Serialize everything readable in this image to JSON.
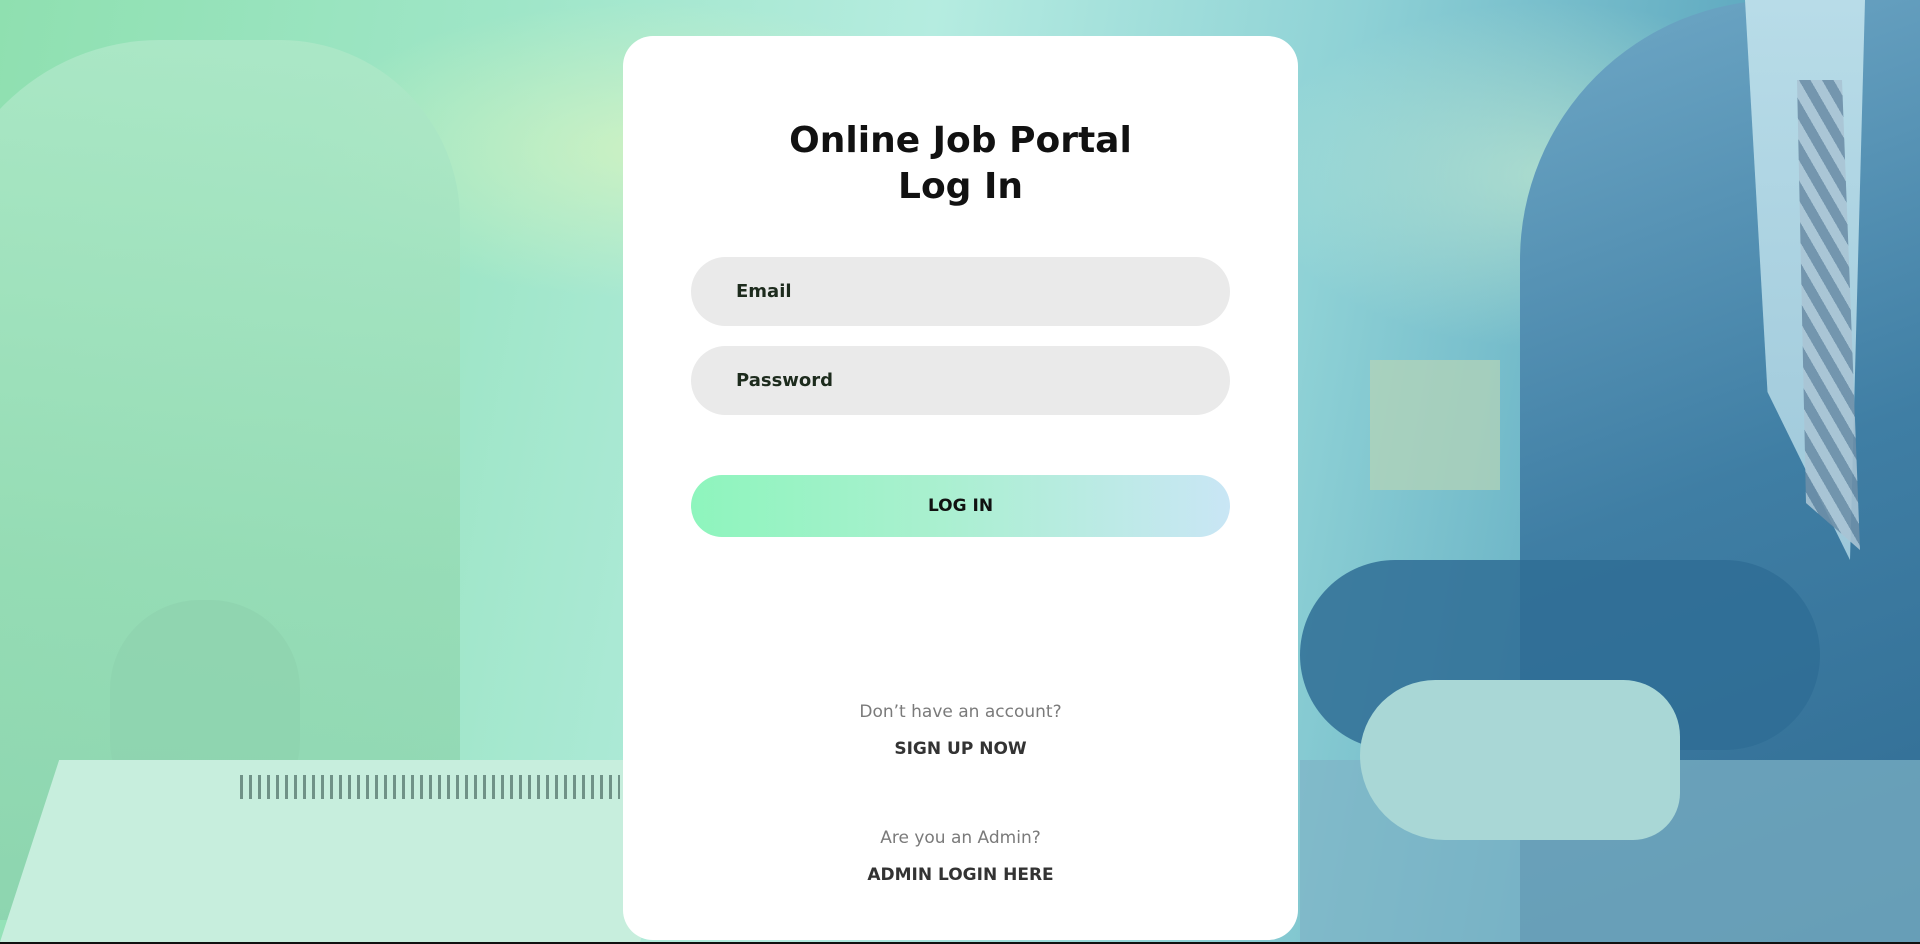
{
  "login": {
    "title_line1": "Online Job Portal",
    "title_line2": "Log In",
    "email_placeholder": "Email",
    "password_placeholder": "Password",
    "login_button": "LOG IN",
    "signup_prompt": "Don’t have an account?",
    "signup_link": "SIGN UP NOW",
    "admin_prompt": "Are you an Admin?",
    "admin_link": "ADMIN LOGIN HERE"
  },
  "colors": {
    "card_background": "#ffffff",
    "input_background": "#eaeaea",
    "button_gradient_start": "#8ef5bd",
    "button_gradient_end": "#c9e6f5",
    "background_overlay_left": "#8fe0b0",
    "background_overlay_right": "#3d7fa6"
  }
}
